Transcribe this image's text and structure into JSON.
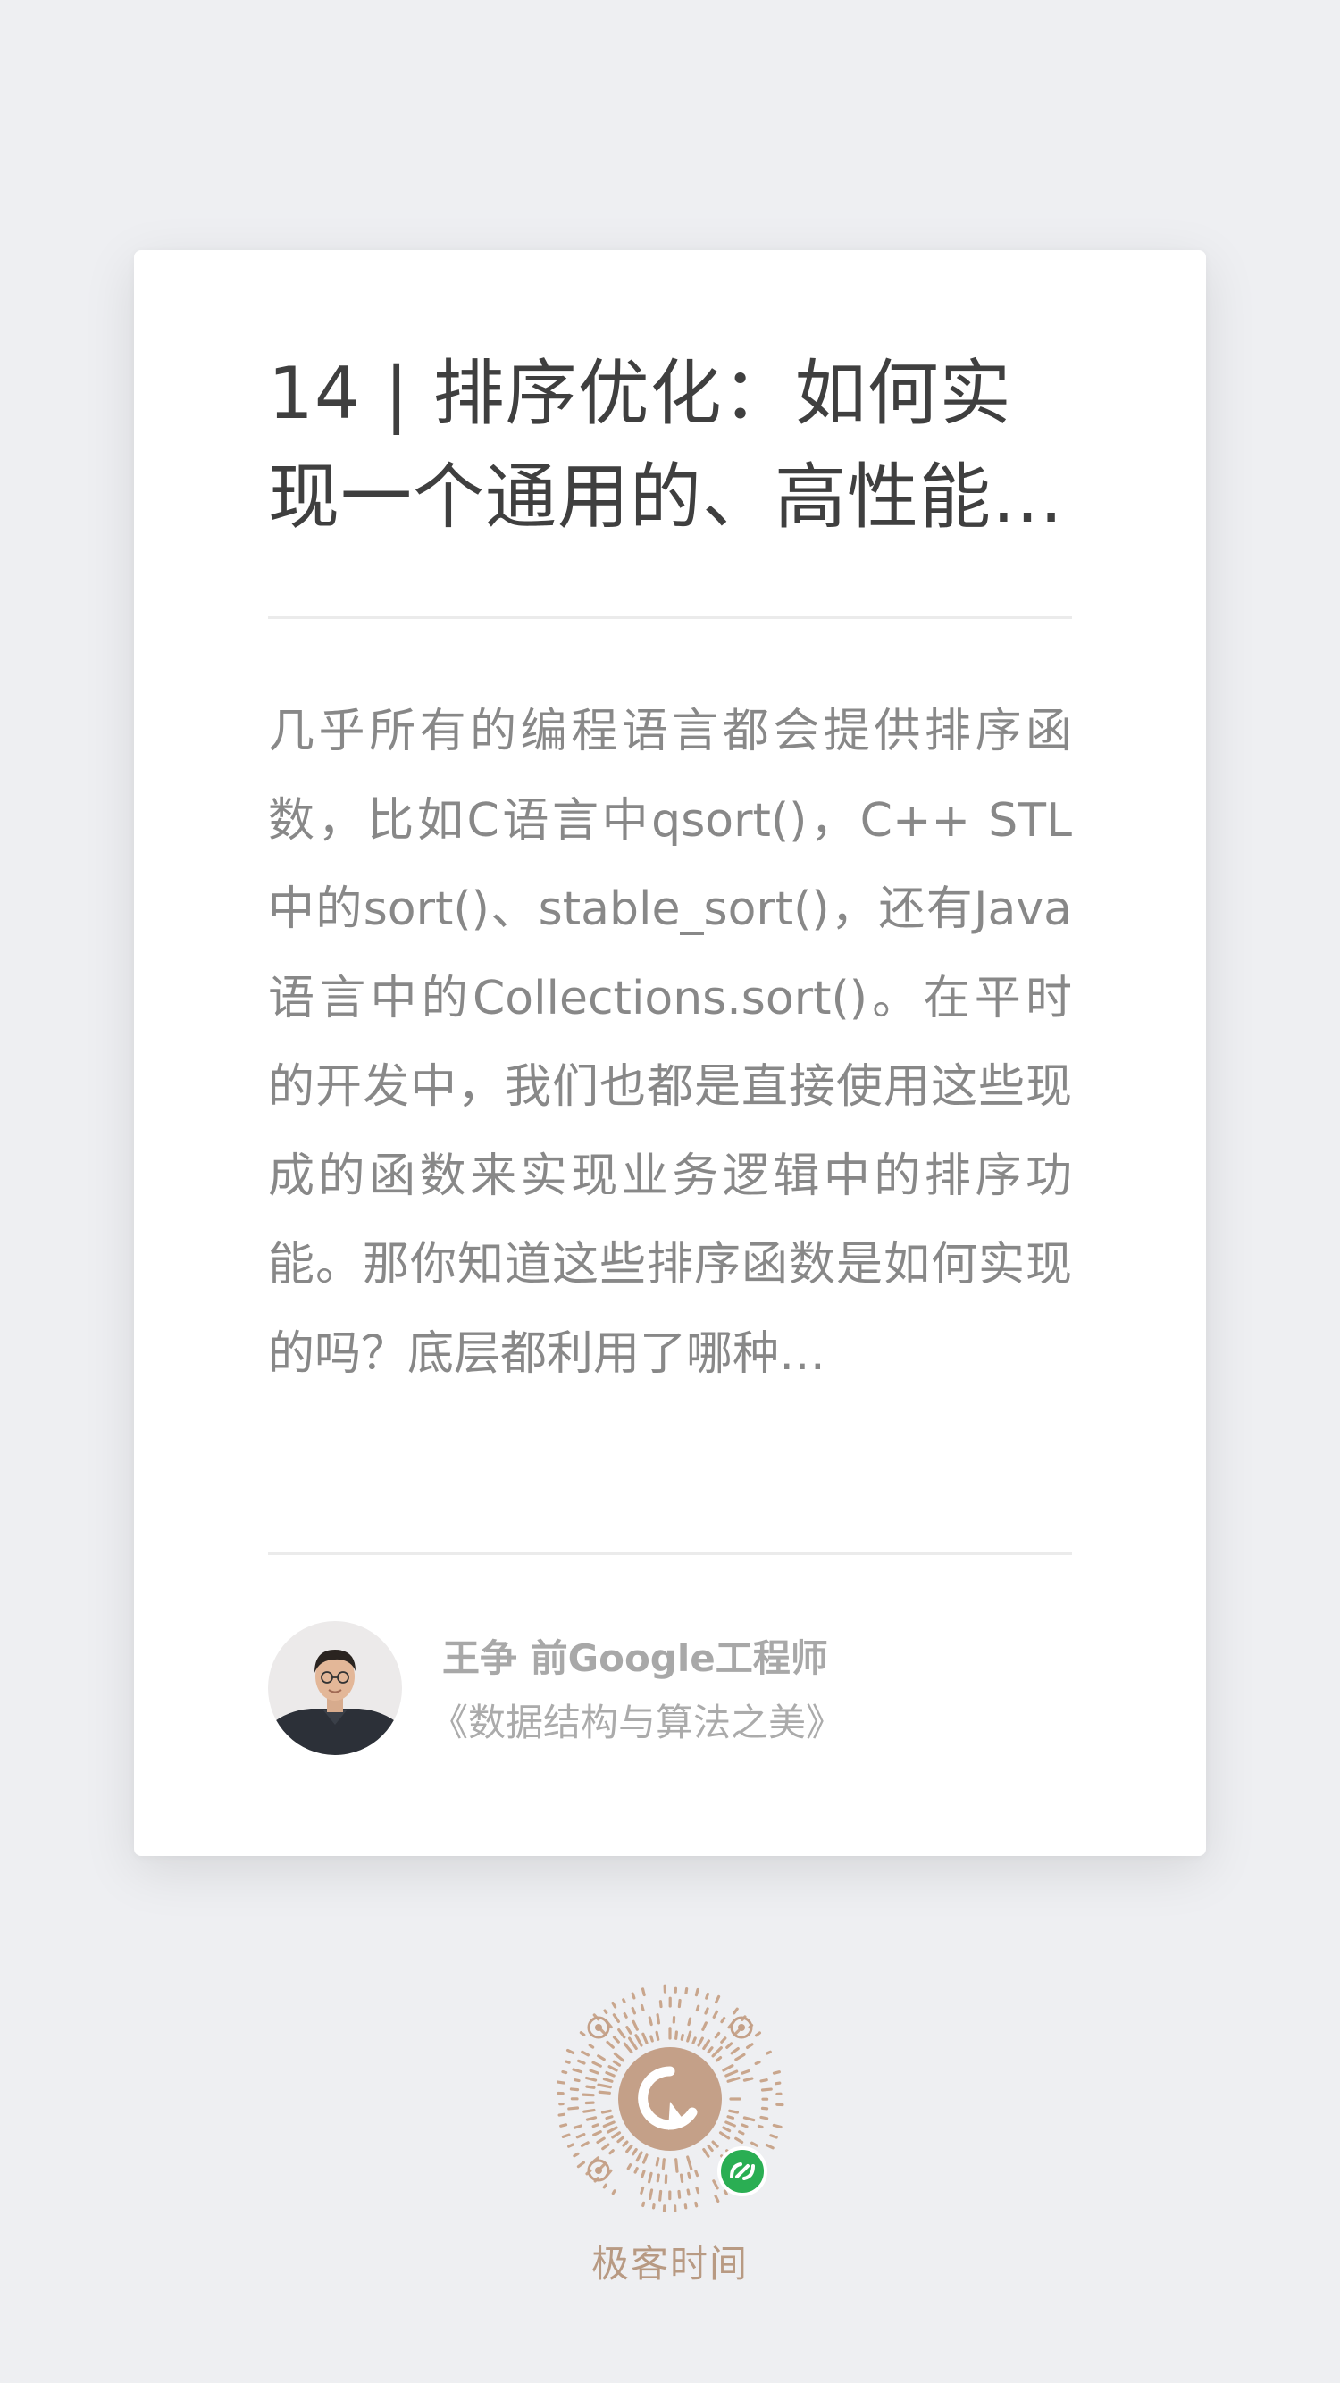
{
  "article": {
    "title": "14 | 排序优化：如何实现一个通用的、高性能…",
    "summary": "几乎所有的编程语言都会提供排序函数，比如C语言中qsort()，C++ STL中的sort()、stable_sort()，还有Java语言中的Collections.sort()。在平时的开发中，我们也都是直接使用这些现成的函数来实现业务逻辑中的排序功能。那你知道这些排序函数是如何实现的吗？底层都利用了哪种…"
  },
  "author": {
    "name_line": "王争 前Google工程师",
    "course": "《数据结构与算法之美》"
  },
  "footer": {
    "brand": "极客时间"
  },
  "colors": {
    "background": "#eeeff2",
    "card": "#ffffff",
    "brand": "#b89a83",
    "wechat_badge": "#2aae53"
  },
  "icons": {
    "qr": "wechat-miniprogram-code",
    "badge": "miniprogram-link-icon"
  }
}
